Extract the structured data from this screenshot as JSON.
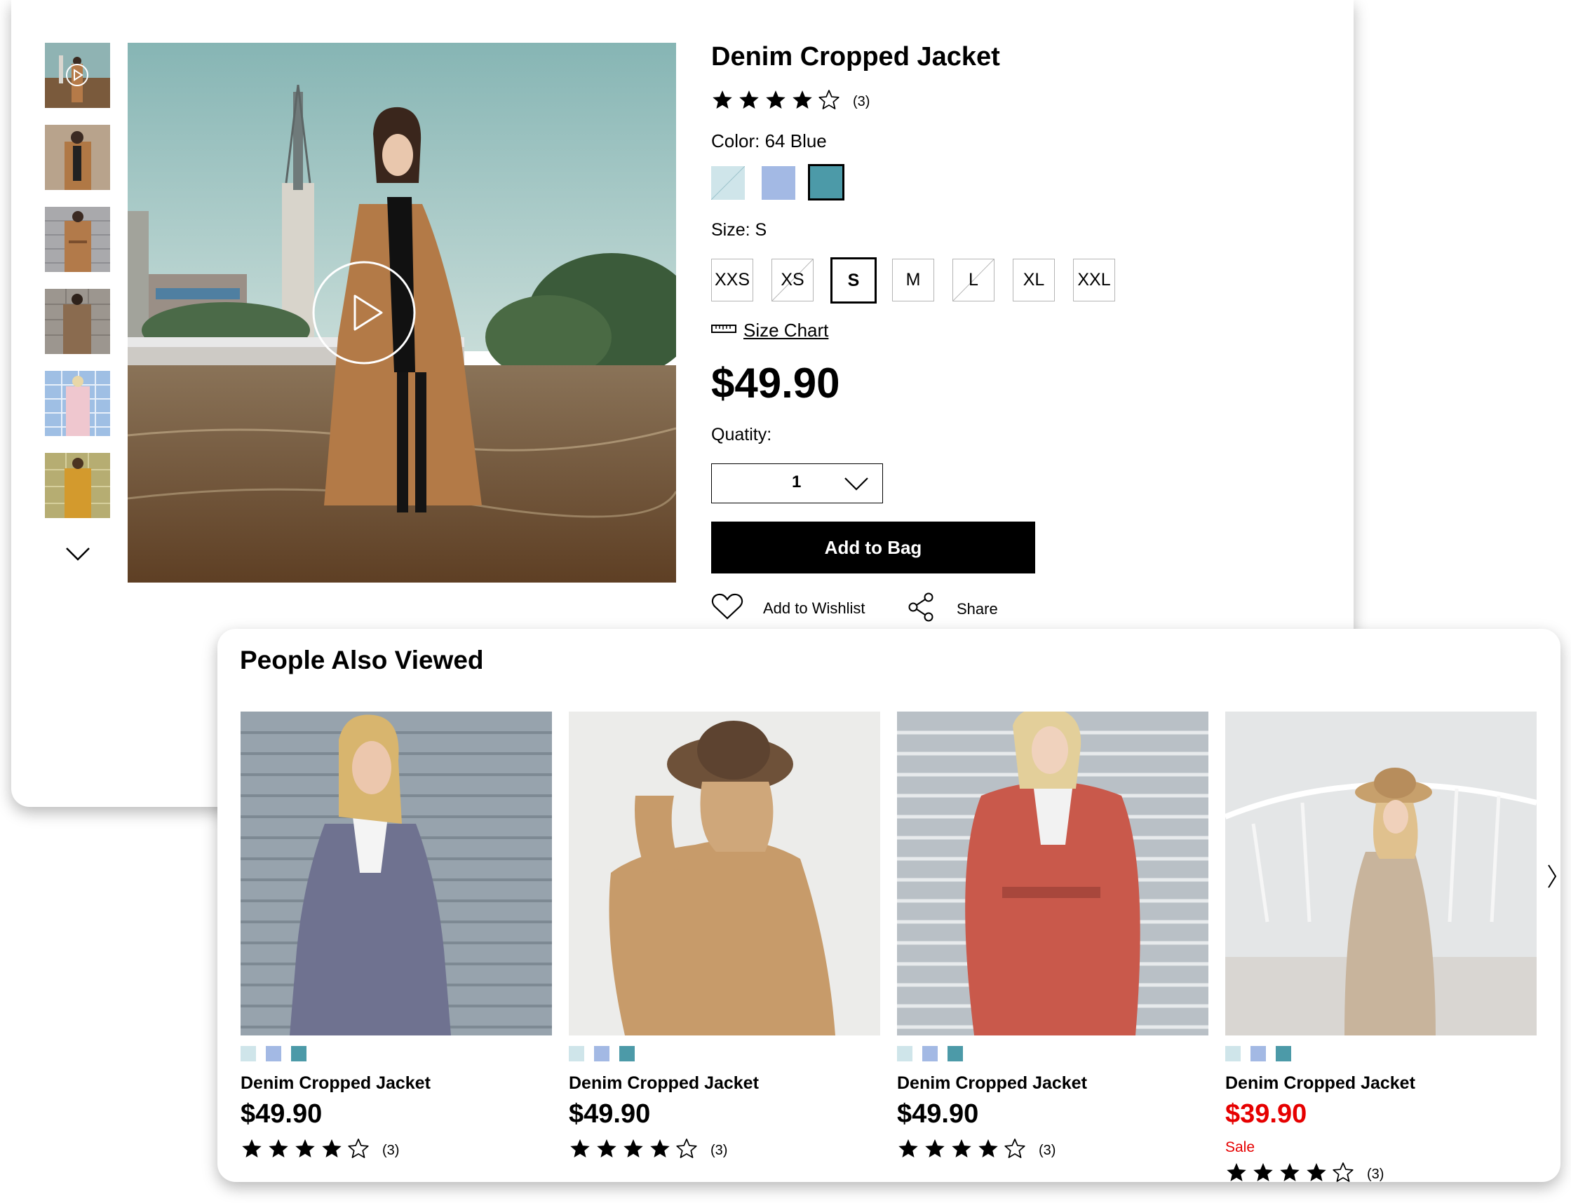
{
  "product": {
    "title": "Denim Cropped Jacket",
    "rating": 4,
    "review_count": "(3)",
    "color_label": "Color: 64 Blue",
    "colors": [
      {
        "name": "light blue",
        "hex": "#cfe5ea",
        "available": false
      },
      {
        "name": "periwinkle",
        "hex": "#a3b9e4",
        "available": true
      },
      {
        "name": "teal",
        "hex": "#4c9aa8",
        "available": true,
        "selected": true
      }
    ],
    "size_label": "Size: S",
    "sizes": [
      {
        "label": "XXS",
        "available": true
      },
      {
        "label": "XS",
        "available": false
      },
      {
        "label": "S",
        "available": true,
        "selected": true
      },
      {
        "label": "M",
        "available": true
      },
      {
        "label": "L",
        "available": false
      },
      {
        "label": "XL",
        "available": true
      },
      {
        "label": "XXL",
        "available": true
      }
    ],
    "size_chart_label": "Size Chart",
    "price": "$49.90",
    "quantity_label": "Quatity:",
    "quantity_value": "1",
    "add_to_bag_label": "Add to Bag",
    "wishlist_label": "Add to Wishlist",
    "share_label": "Share",
    "gallery_thumbnails": 6
  },
  "people_also_viewed": {
    "title": "People Also Viewed",
    "swatch_colors": [
      "#cfe5ea",
      "#a3b9e4",
      "#4c9aa8"
    ],
    "items": [
      {
        "name": "Denim Cropped Jacket",
        "price": "$49.90",
        "sale": false,
        "sale_label": "",
        "rating": 4,
        "review_count": "(3)",
        "coat_color": "#6f7290"
      },
      {
        "name": "Denim Cropped Jacket",
        "price": "$49.90",
        "sale": false,
        "sale_label": "",
        "rating": 4,
        "review_count": "(3)",
        "coat_color": "#c79b6a"
      },
      {
        "name": "Denim Cropped Jacket",
        "price": "$49.90",
        "sale": false,
        "sale_label": "",
        "rating": 4,
        "review_count": "(3)",
        "coat_color": "#c9594b"
      },
      {
        "name": "Denim Cropped Jacket",
        "price": "$39.90",
        "sale": true,
        "sale_label": "Sale",
        "rating": 4,
        "review_count": "(3)",
        "coat_color": "#c8b49c"
      }
    ]
  },
  "colors": {
    "sale_red": "#e60000",
    "button_black": "#000000"
  }
}
